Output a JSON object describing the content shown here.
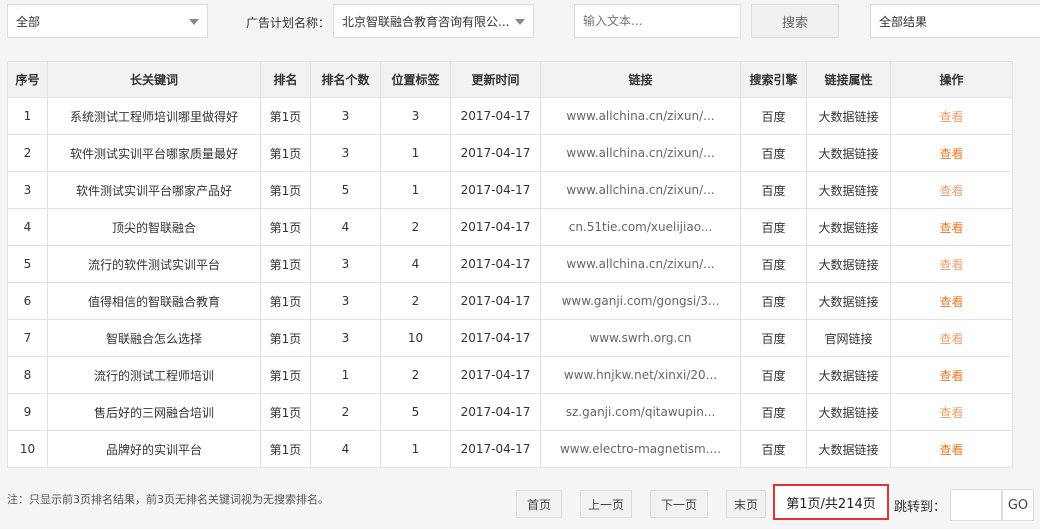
{
  "filters": {
    "scope_select": "全部",
    "plan_label": "广告计划名称：",
    "plan_select": "北京智联融合教育咨询有限公...",
    "search_placeholder": "输入文本...",
    "search_button": "搜索",
    "result_select": "全部结果"
  },
  "table": {
    "headers": [
      "序号",
      "长关键词",
      "排名",
      "排名个数",
      "位置标签",
      "更新时间",
      "链接",
      "搜索引擎",
      "链接属性",
      "操作"
    ],
    "rows": [
      [
        "1",
        "系统测试工程师培训哪里做得好",
        "第1页",
        "3",
        "3",
        "2017-04-17",
        "www.allchina.cn/zixun/...",
        "百度",
        "大数据链接",
        "查看"
      ],
      [
        "2",
        "软件测试实训平台哪家质量最好",
        "第1页",
        "3",
        "1",
        "2017-04-17",
        "www.allchina.cn/zixun/...",
        "百度",
        "大数据链接",
        "查看"
      ],
      [
        "3",
        "软件测试实训平台哪家产品好",
        "第1页",
        "5",
        "1",
        "2017-04-17",
        "www.allchina.cn/zixun/...",
        "百度",
        "大数据链接",
        "查看"
      ],
      [
        "4",
        "顶尖的智联融合",
        "第1页",
        "4",
        "2",
        "2017-04-17",
        "cn.51tie.com/xuelijiao...",
        "百度",
        "大数据链接",
        "查看"
      ],
      [
        "5",
        "流行的软件测试实训平台",
        "第1页",
        "3",
        "4",
        "2017-04-17",
        "www.allchina.cn/zixun/...",
        "百度",
        "大数据链接",
        "查看"
      ],
      [
        "6",
        "值得相信的智联融合教育",
        "第1页",
        "3",
        "2",
        "2017-04-17",
        "www.ganji.com/gongsi/3...",
        "百度",
        "大数据链接",
        "查看"
      ],
      [
        "7",
        "智联融合怎么选择",
        "第1页",
        "3",
        "10",
        "2017-04-17",
        "www.swrh.org.cn",
        "百度",
        "官网链接",
        "查看"
      ],
      [
        "8",
        "流行的测试工程师培训",
        "第1页",
        "1",
        "2",
        "2017-04-17",
        "www.hnjkw.net/xinxi/20...",
        "百度",
        "大数据链接",
        "查看"
      ],
      [
        "9",
        "售后好的三网融合培训",
        "第1页",
        "2",
        "5",
        "2017-04-17",
        "sz.ganji.com/qitawupin...",
        "百度",
        "大数据链接",
        "查看"
      ],
      [
        "10",
        "品牌好的实训平台",
        "第1页",
        "4",
        "1",
        "2017-04-17",
        "www.electro-magnetism....",
        "百度",
        "大数据链接",
        "查看"
      ]
    ]
  },
  "footer": {
    "note": "注：只显示前3页排名结果，前3页无排名关键词视为无搜索排名。",
    "first": "首页",
    "prev": "上一页",
    "next": "下一页",
    "last": "末页",
    "page_info": "第1页/共214页",
    "jump_label": "跳转到：",
    "jump_value": "",
    "go": "GO"
  },
  "colors": {
    "accent": "#f07828",
    "highlight_border": "#e83232"
  }
}
